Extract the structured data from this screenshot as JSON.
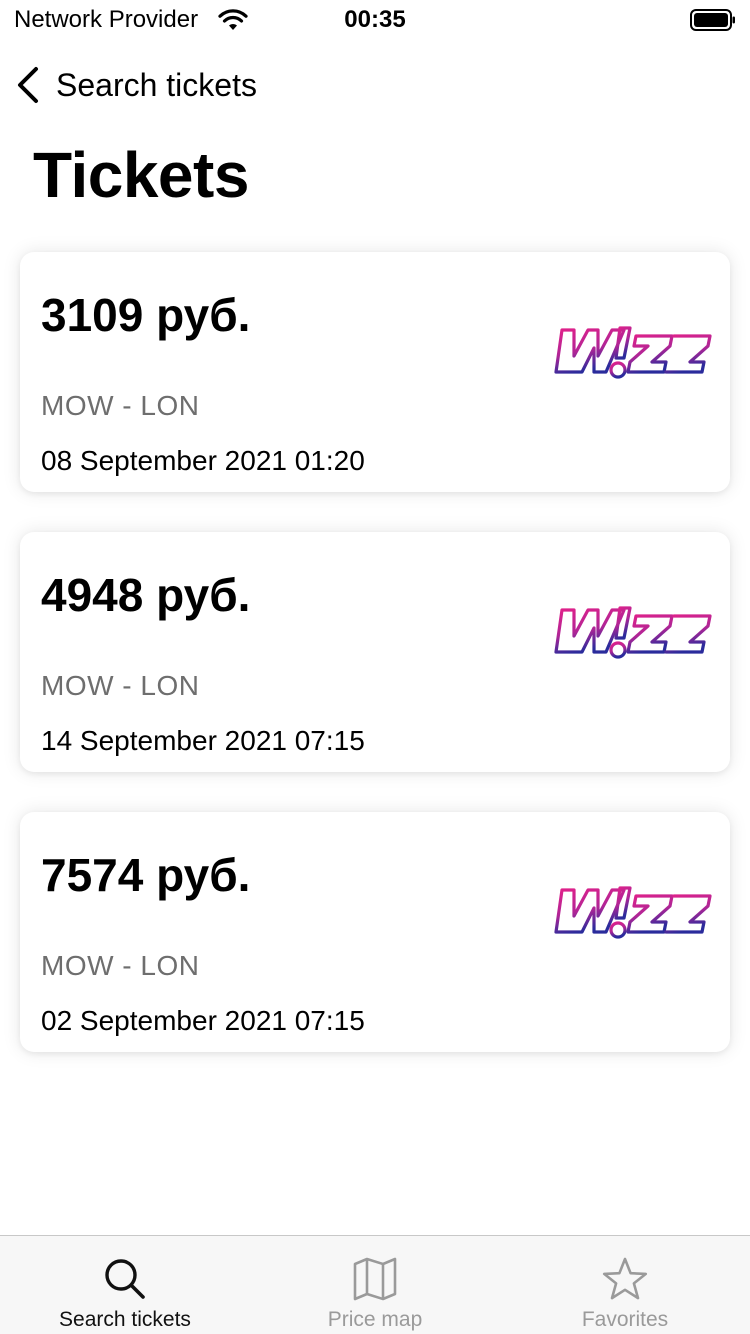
{
  "status_bar": {
    "carrier": "Network Provider",
    "time": "00:35"
  },
  "nav": {
    "back_label": "Search tickets",
    "title": "Tickets"
  },
  "tickets": [
    {
      "price": "3109 руб.",
      "route": "MOW - LON",
      "date": "08 September 2021 01:20",
      "airline_logo": "Wizz"
    },
    {
      "price": "4948 руб.",
      "route": "MOW - LON",
      "date": "14 September 2021 07:15",
      "airline_logo": "Wizz"
    },
    {
      "price": "7574 руб.",
      "route": "MOW - LON",
      "date": "02 September 2021 07:15",
      "airline_logo": "Wizz"
    }
  ],
  "tab_bar": {
    "tabs": [
      {
        "label": "Search tickets",
        "icon": "search-icon",
        "active": true
      },
      {
        "label": "Price map",
        "icon": "map-icon",
        "active": false
      },
      {
        "label": "Favorites",
        "icon": "star-icon",
        "active": false
      }
    ]
  },
  "colors": {
    "logo_pink": "#e0218a",
    "logo_blue": "#2a2b9c",
    "inactive_tab": "#9a9a9a",
    "secondary_text": "#6e6e6e"
  }
}
